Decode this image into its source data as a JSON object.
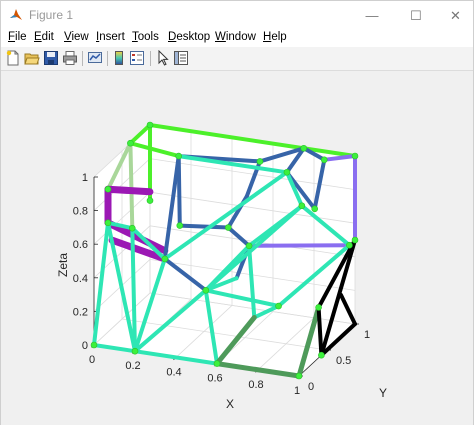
{
  "window": {
    "title": "Figure 1",
    "minimize_glyph": "—",
    "maximize_glyph": "☐",
    "close_glyph": "✕"
  },
  "menu": [
    {
      "key": "file",
      "ul": "F",
      "rest": "ile"
    },
    {
      "key": "edit",
      "ul": "E",
      "rest": "dit"
    },
    {
      "key": "view",
      "ul": "V",
      "rest": "iew"
    },
    {
      "key": "insert",
      "ul": "I",
      "rest": "nsert"
    },
    {
      "key": "tools",
      "ul": "T",
      "rest": "ools"
    },
    {
      "key": "desktop",
      "ul": "D",
      "rest": "esktop"
    },
    {
      "key": "window",
      "ul": "W",
      "rest": "indow"
    },
    {
      "key": "help",
      "ul": "H",
      "rest": "elp"
    }
  ],
  "toolbar": {
    "icons": [
      "new-figure-icon",
      "open-file-icon",
      "save-icon",
      "print-icon",
      "link-plot-icon",
      "colorbar-icon",
      "legend-icon",
      "edit-plot-icon",
      "property-inspector-icon"
    ]
  },
  "axes": {
    "xlabel": "X",
    "ylabel": "Y",
    "zlabel": "Zeta",
    "x_ticks": [
      "0",
      "0.2",
      "0.4",
      "0.6",
      "0.8",
      "1"
    ],
    "y_ticks": [
      "0",
      "0.5",
      "1"
    ],
    "z_ticks": [
      "0",
      "0.2",
      "0.4",
      "0.6",
      "0.8",
      "1"
    ],
    "background": "#ffffff",
    "figure_color": "#f0f0f0"
  },
  "colors": {
    "green": "#4cf02a",
    "light_green": "#a9d79a",
    "blue": "#3764a8",
    "teal": "#2ee6b4",
    "purple": "#9b18b4",
    "lavender": "#8a6ef0",
    "dark_green": "#4e9a5a",
    "black": "#000000",
    "vertex": "#3cf03c"
  },
  "chart_data": {
    "type": "line3d",
    "title": "",
    "xlabel": "X",
    "ylabel": "Y",
    "zlabel": "Zeta",
    "xlim": [
      0,
      1
    ],
    "ylim": [
      0,
      1
    ],
    "zlim": [
      0,
      1
    ],
    "grid": true,
    "segments": [
      {
        "c": "green",
        "p": [
          [
            0,
            1,
            1
          ],
          [
            1,
            1,
            1
          ]
        ]
      },
      {
        "c": "green",
        "p": [
          [
            0,
            1,
            1
          ],
          [
            0,
            1,
            0.55
          ]
        ]
      },
      {
        "c": "green",
        "p": [
          [
            0,
            1,
            1
          ],
          [
            0,
            0.65,
            1
          ]
        ]
      },
      {
        "c": "green",
        "p": [
          [
            0,
            0.65,
            1
          ],
          [
            0.2,
            0.78,
            0.92
          ]
        ]
      },
      {
        "c": "light_green",
        "p": [
          [
            0,
            0.65,
            1
          ],
          [
            0,
            0.25,
            0.85
          ]
        ]
      },
      {
        "c": "light_green",
        "p": [
          [
            0,
            0.65,
            1
          ],
          [
            0.05,
            0.5,
            0.55
          ]
        ]
      },
      {
        "c": "purple",
        "p": [
          [
            0,
            0.25,
            0.85
          ],
          [
            0,
            0.25,
            0.65
          ]
        ]
      },
      {
        "c": "purple",
        "p": [
          [
            0,
            0.25,
            0.85
          ],
          [
            0.15,
            0.45,
            0.8
          ]
        ]
      },
      {
        "c": "purple",
        "p": [
          [
            0,
            0.25,
            0.65
          ],
          [
            0.25,
            0.35,
            0.5
          ]
        ]
      },
      {
        "c": "purple",
        "p": [
          [
            0.02,
            0.25,
            0.55
          ],
          [
            0.25,
            0.35,
            0.45
          ]
        ]
      },
      {
        "c": "blue",
        "p": [
          [
            0.2,
            0.78,
            0.92
          ],
          [
            0.2,
            0.8,
            0.5
          ]
        ]
      },
      {
        "c": "blue",
        "p": [
          [
            0.2,
            0.78,
            0.92
          ],
          [
            0.55,
            0.95,
            0.9
          ]
        ]
      },
      {
        "c": "blue",
        "p": [
          [
            0.55,
            0.95,
            0.9
          ],
          [
            0.75,
            1,
            1
          ]
        ]
      },
      {
        "c": "blue",
        "p": [
          [
            0.55,
            0.95,
            0.9
          ],
          [
            0.5,
            0.9,
            0.7
          ]
        ]
      },
      {
        "c": "blue",
        "p": [
          [
            0.75,
            1,
            1
          ],
          [
            0.75,
            0.7,
            0.95
          ]
        ]
      },
      {
        "c": "blue",
        "p": [
          [
            0.75,
            1,
            1
          ],
          [
            0.85,
            1,
            0.95
          ]
        ]
      },
      {
        "c": "blue",
        "p": [
          [
            0.75,
            0.7,
            0.95
          ],
          [
            0.88,
            0.72,
            0.75
          ]
        ]
      },
      {
        "c": "blue",
        "p": [
          [
            0.88,
            0.72,
            0.75
          ],
          [
            0.85,
            1,
            0.95
          ]
        ]
      },
      {
        "c": "blue",
        "p": [
          [
            0.2,
            0.8,
            0.5
          ],
          [
            0.45,
            0.75,
            0.55
          ]
        ]
      },
      {
        "c": "blue",
        "p": [
          [
            0.2,
            0.78,
            0.92
          ],
          [
            0.25,
            0.35,
            0.45
          ]
        ]
      },
      {
        "c": "blue",
        "p": [
          [
            0.5,
            0.9,
            0.7
          ],
          [
            0.45,
            0.75,
            0.55
          ]
        ]
      },
      {
        "c": "blue",
        "p": [
          [
            0.45,
            0.75,
            0.55
          ],
          [
            0.62,
            0.5,
            0.55
          ]
        ]
      },
      {
        "c": "blue",
        "p": [
          [
            0.62,
            0.5,
            0.55
          ],
          [
            0.6,
            0.35,
            0.4
          ]
        ]
      },
      {
        "c": "blue",
        "p": [
          [
            0.25,
            0.35,
            0.45
          ],
          [
            0.45,
            0.35,
            0.3
          ]
        ]
      },
      {
        "c": "lavender",
        "p": [
          [
            1,
            1,
            1
          ],
          [
            0.85,
            1,
            0.95
          ]
        ]
      },
      {
        "c": "lavender",
        "p": [
          [
            1,
            1,
            1
          ],
          [
            1,
            1,
            0.5
          ]
        ]
      },
      {
        "c": "lavender",
        "p": [
          [
            0.62,
            0.5,
            0.55
          ],
          [
            1,
            0.9,
            0.5
          ]
        ]
      },
      {
        "c": "teal",
        "p": [
          [
            0.2,
            0.78,
            0.92
          ],
          [
            0.75,
            0.7,
            0.95
          ]
        ]
      },
      {
        "c": "teal",
        "p": [
          [
            0.25,
            0.35,
            0.45
          ],
          [
            0.75,
            0.7,
            0.95
          ]
        ]
      },
      {
        "c": "teal",
        "p": [
          [
            0.75,
            0.7,
            0.95
          ],
          [
            0.85,
            0.6,
            0.8
          ]
        ]
      },
      {
        "c": "teal",
        "p": [
          [
            0.85,
            0.6,
            0.8
          ],
          [
            0.62,
            0.5,
            0.55
          ]
        ]
      },
      {
        "c": "teal",
        "p": [
          [
            0.85,
            0.6,
            0.8
          ],
          [
            1,
            0.9,
            0.5
          ]
        ]
      },
      {
        "c": "teal",
        "p": [
          [
            0.45,
            0.35,
            0.3
          ],
          [
            0.62,
            0.5,
            0.55
          ]
        ]
      },
      {
        "c": "teal",
        "p": [
          [
            0.45,
            0.35,
            0.3
          ],
          [
            0.6,
            0.35,
            0.4
          ]
        ]
      },
      {
        "c": "teal",
        "p": [
          [
            0.45,
            0.35,
            0.3
          ],
          [
            0.85,
            0.6,
            0.8
          ]
        ]
      },
      {
        "c": "teal",
        "p": [
          [
            0,
            0.25,
            0.65
          ],
          [
            0,
            0,
            0
          ]
        ]
      },
      {
        "c": "teal",
        "p": [
          [
            0,
            0.25,
            0.65
          ],
          [
            0.2,
            0,
            0
          ]
        ]
      },
      {
        "c": "teal",
        "p": [
          [
            0,
            0,
            0
          ],
          [
            0.6,
            0,
            0
          ]
        ]
      },
      {
        "c": "teal",
        "p": [
          [
            0.25,
            0.35,
            0.45
          ],
          [
            0.2,
            0,
            0
          ]
        ]
      },
      {
        "c": "teal",
        "p": [
          [
            0.2,
            0,
            0
          ],
          [
            0.45,
            0.35,
            0.3
          ]
        ]
      },
      {
        "c": "teal",
        "p": [
          [
            0.05,
            0.5,
            0.55
          ],
          [
            0.2,
            0,
            0
          ]
        ]
      },
      {
        "c": "teal",
        "p": [
          [
            0.05,
            0.5,
            0.55
          ],
          [
            0.25,
            0.35,
            0.45
          ]
        ]
      },
      {
        "c": "teal",
        "p": [
          [
            0.6,
            0,
            0
          ],
          [
            0.45,
            0.35,
            0.3
          ]
        ]
      },
      {
        "c": "teal",
        "p": [
          [
            0,
            0.25,
            0.65
          ],
          [
            0.05,
            0.5,
            0.55
          ]
        ]
      },
      {
        "c": "teal",
        "p": [
          [
            0.45,
            0.35,
            0.3
          ],
          [
            0.75,
            0.55,
            0.2
          ]
        ]
      },
      {
        "c": "teal",
        "p": [
          [
            0.75,
            0.55,
            0.2
          ],
          [
            1,
            0.9,
            0.5
          ]
        ]
      },
      {
        "c": "teal",
        "p": [
          [
            0.75,
            0.55,
            0.2
          ],
          [
            0.7,
            0.3,
            0.2
          ]
        ]
      },
      {
        "c": "teal",
        "p": [
          [
            0.62,
            0.5,
            0.55
          ],
          [
            0.7,
            0.3,
            0.2
          ]
        ]
      },
      {
        "c": "dark_green",
        "p": [
          [
            0.6,
            0,
            0
          ],
          [
            1,
            0,
            0
          ]
        ]
      },
      {
        "c": "dark_green",
        "p": [
          [
            0.6,
            0,
            0
          ],
          [
            0.7,
            0.3,
            0.2
          ]
        ]
      },
      {
        "c": "dark_green",
        "p": [
          [
            1,
            0,
            0
          ],
          [
            1,
            0.35,
            0.3
          ]
        ]
      },
      {
        "c": "black",
        "p": [
          [
            1,
            0.35,
            0.3
          ],
          [
            1,
            1,
            0.5
          ]
        ]
      },
      {
        "c": "black",
        "p": [
          [
            1,
            0.35,
            0.3
          ],
          [
            1,
            0.4,
            0
          ]
        ]
      },
      {
        "c": "black",
        "p": [
          [
            1,
            0.4,
            0
          ],
          [
            1,
            1,
            0.5
          ]
        ]
      },
      {
        "c": "black",
        "p": [
          [
            1,
            0.4,
            0
          ],
          [
            1,
            1,
            0
          ]
        ]
      },
      {
        "c": "black",
        "p": [
          [
            1,
            0.75,
            0.25
          ],
          [
            1,
            1,
            0
          ]
        ]
      }
    ],
    "vertices": [
      [
        0,
        1,
        1
      ],
      [
        1,
        1,
        1
      ],
      [
        0,
        0.65,
        1
      ],
      [
        0.2,
        0.78,
        0.92
      ],
      [
        0,
        0.25,
        0.85
      ],
      [
        0,
        0.25,
        0.65
      ],
      [
        0.55,
        0.95,
        0.9
      ],
      [
        0.75,
        1,
        1
      ],
      [
        0.85,
        1,
        0.95
      ],
      [
        0.75,
        0.7,
        0.95
      ],
      [
        0.88,
        0.72,
        0.75
      ],
      [
        0.2,
        0.8,
        0.5
      ],
      [
        0.25,
        0.35,
        0.45
      ],
      [
        0.45,
        0.75,
        0.55
      ],
      [
        0.62,
        0.5,
        0.55
      ],
      [
        0.45,
        0.35,
        0.3
      ],
      [
        0.85,
        0.6,
        0.8
      ],
      [
        1,
        0.9,
        0.5
      ],
      [
        1,
        1,
        0.5
      ],
      [
        0,
        0,
        0
      ],
      [
        0.2,
        0,
        0
      ],
      [
        0.6,
        0,
        0
      ],
      [
        1,
        0,
        0
      ],
      [
        0.05,
        0.5,
        0.55
      ],
      [
        0.75,
        0.55,
        0.2
      ],
      [
        1,
        0.35,
        0.3
      ],
      [
        1,
        0.4,
        0
      ],
      [
        0,
        1,
        0.55
      ]
    ]
  }
}
